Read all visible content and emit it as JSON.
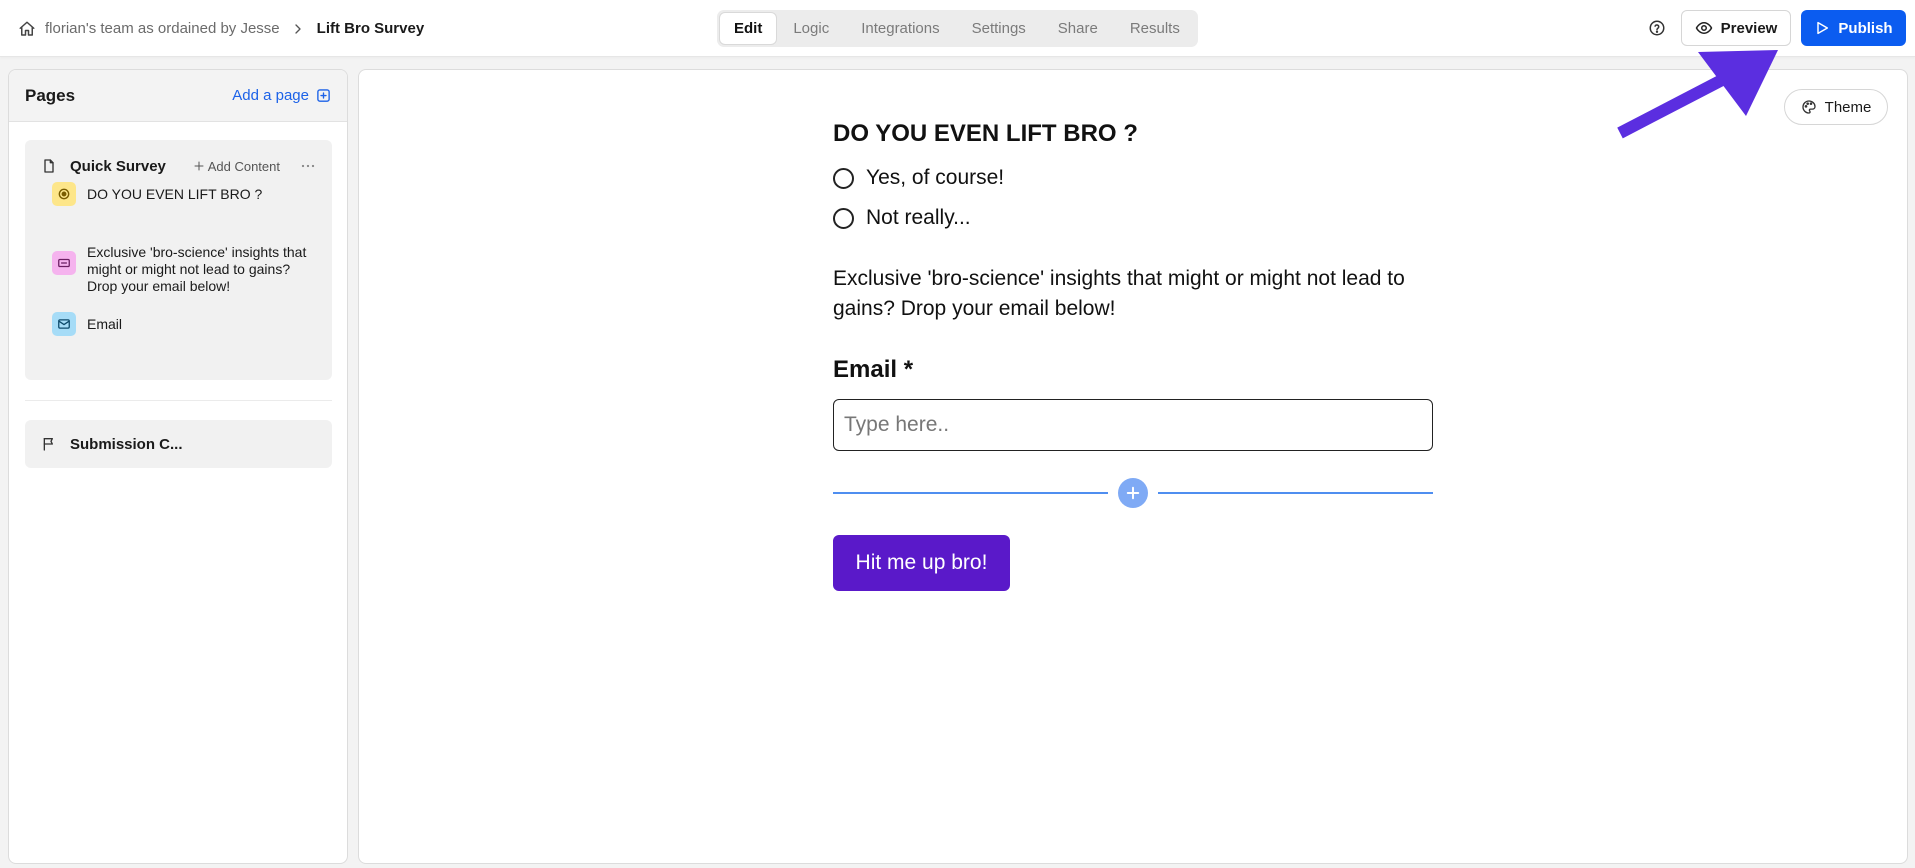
{
  "breadcrumb": {
    "home_icon": "home-icon",
    "team": "florian's team as ordained by Jesse",
    "current": "Lift Bro Survey"
  },
  "tabs": [
    {
      "label": "Edit",
      "active": true
    },
    {
      "label": "Logic"
    },
    {
      "label": "Integrations"
    },
    {
      "label": "Settings"
    },
    {
      "label": "Share"
    },
    {
      "label": "Results"
    }
  ],
  "header_actions": {
    "help_icon": "help-circle-icon",
    "preview_label": "Preview",
    "publish_label": "Publish",
    "publish_color": "#0b5cf0"
  },
  "sidebar": {
    "title": "Pages",
    "add_page_label": "Add a page",
    "pages": [
      {
        "name": "Quick Survey",
        "add_content_label": "Add Content",
        "items": [
          {
            "label": "DO YOU EVEN LIFT BRO ?",
            "icon": "radio-target-icon",
            "icon_color": "#fde68a"
          },
          {
            "label": "Exclusive 'bro-science' insights that might or might not lead to gains? Drop your email below!",
            "icon": "text-block-icon",
            "icon_color": "#f5b3ee"
          },
          {
            "label": "Email",
            "icon": "mail-icon",
            "icon_color": "#a6dcf7"
          }
        ]
      }
    ],
    "submission_page": "Submission C..."
  },
  "canvas": {
    "theme_label": "Theme",
    "question": "DO YOU EVEN LIFT BRO ?",
    "options": [
      "Yes, of course!",
      "Not really..."
    ],
    "paragraph": "Exclusive 'bro-science' insights that might or might not lead to gains? Drop your email below!",
    "email_label": "Email *",
    "email_placeholder": "Type here..",
    "submit_label": "Hit me up bro!",
    "submit_color": "#5a19c9",
    "annotation_color": "#5b2ee0"
  }
}
